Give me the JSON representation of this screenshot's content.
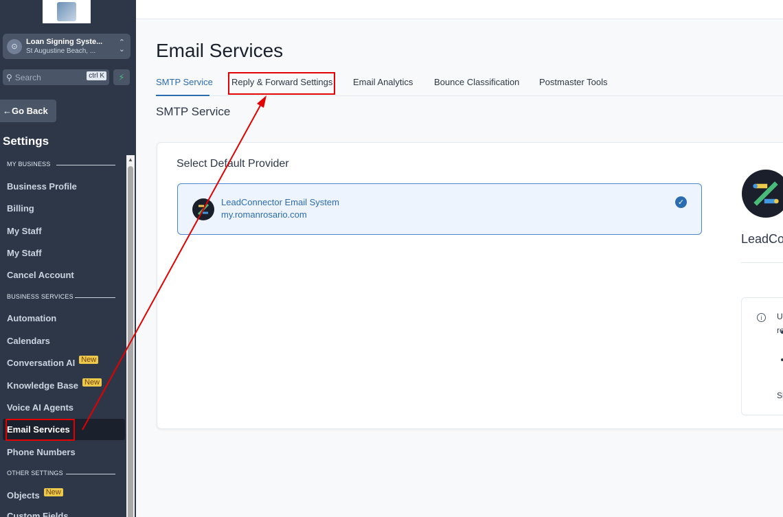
{
  "sidebar": {
    "account": {
      "name": "Loan Signing Syste...",
      "location": "St Augustine Beach, ..."
    },
    "search": {
      "placeholder": "Search",
      "shortcut": "ctrl K"
    },
    "go_back": "Go Back",
    "settings_title": "Settings",
    "sections": [
      {
        "label": "MY BUSINESS",
        "items": [
          "Business Profile",
          "Billing",
          "My Staff",
          "My Staff",
          "Cancel Account"
        ]
      },
      {
        "label": "BUSINESS SERVICES",
        "items": [
          "Automation",
          "Calendars",
          "Conversation AI",
          "Knowledge Base",
          "Voice AI Agents",
          "Email Services",
          "Phone Numbers"
        ]
      },
      {
        "label": "OTHER SETTINGS",
        "items": [
          "Objects",
          "Custom Fields"
        ]
      }
    ],
    "new_badge": "New",
    "active_item": "Email Services"
  },
  "main": {
    "title": "Email Services",
    "tabs": [
      "SMTP Service",
      "Reply & Forward Settings",
      "Email Analytics",
      "Bounce Classification",
      "Postmaster Tools"
    ],
    "active_tab": "SMTP Service",
    "section_title": "SMTP Service",
    "card": {
      "heading": "Select Default Provider",
      "provider": {
        "name": "LeadConnector Email System",
        "domain": "my.romanrosario.com"
      },
      "right_panel": {
        "name": "LeadCor",
        "info_line1": "Us",
        "info_line2": "re",
        "info_line3": "Sh"
      }
    }
  },
  "colors": {
    "sidebar_bg": "#2d3748",
    "accent": "#2b6cb0",
    "annotation": "#e30000",
    "badge": "#ecc94b"
  }
}
